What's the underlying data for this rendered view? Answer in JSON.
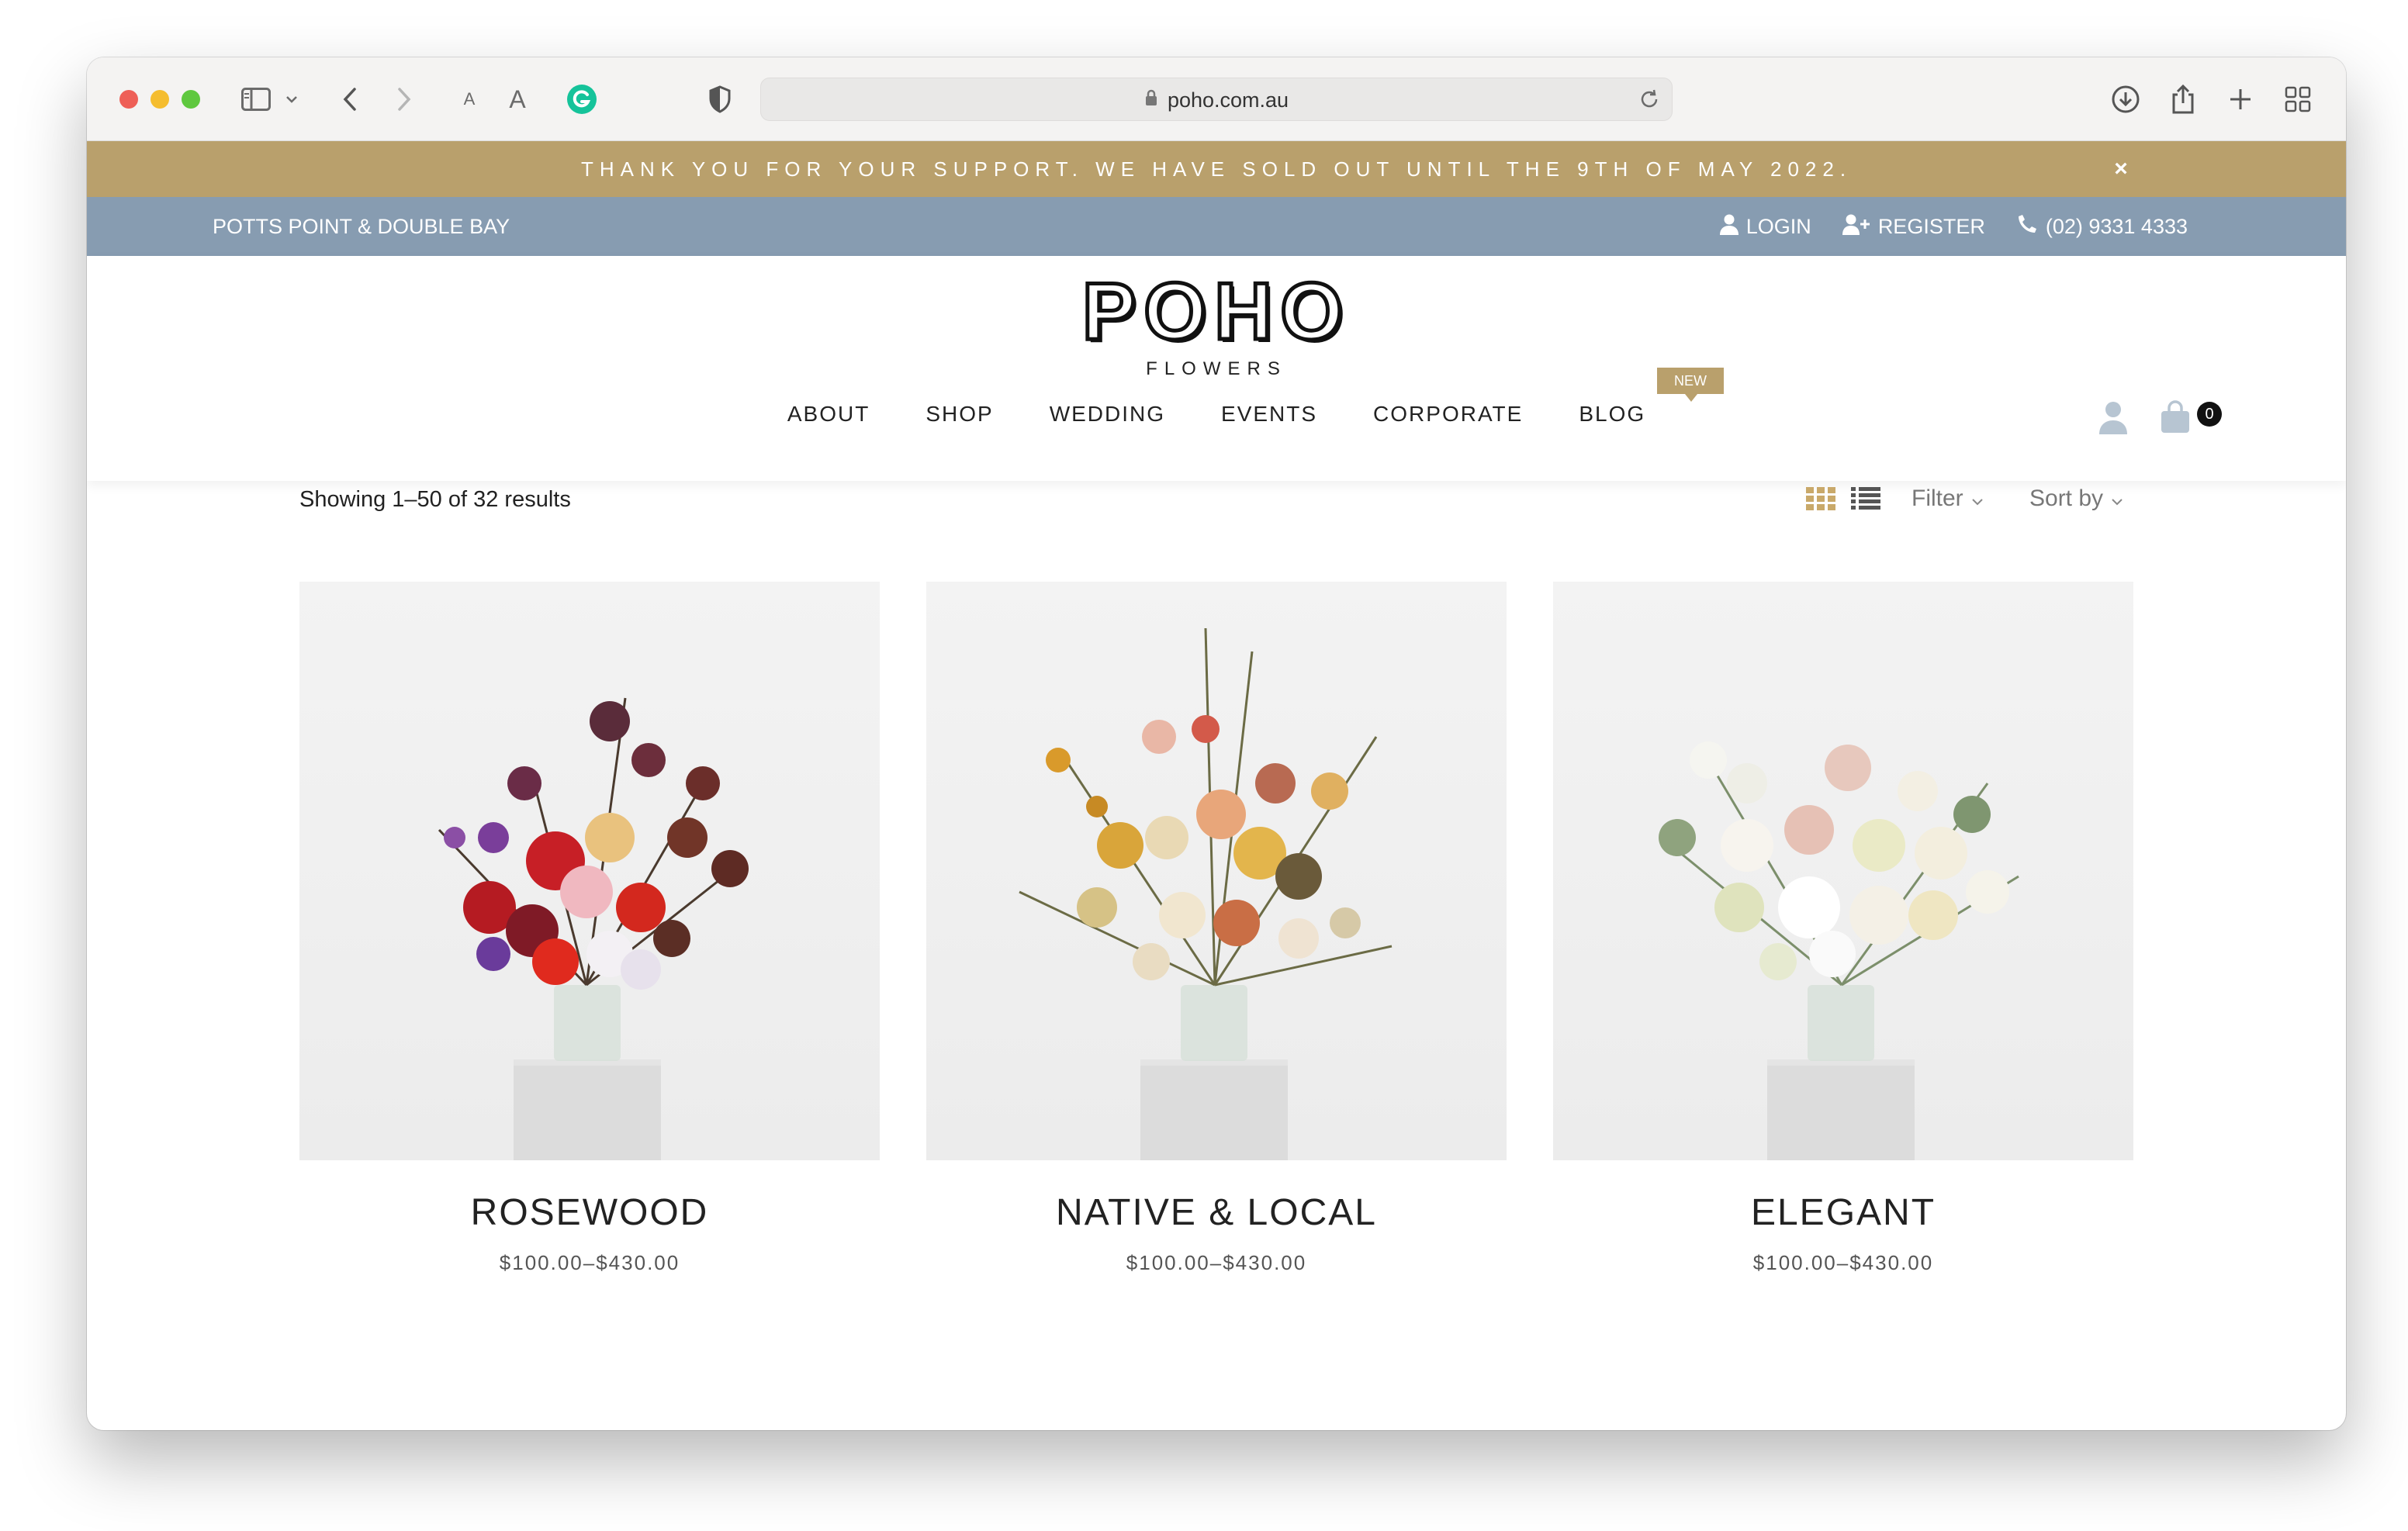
{
  "browser": {
    "url": "poho.com.au",
    "reader_small": "A",
    "reader_large": "A"
  },
  "announcement": {
    "text": "THANK YOU FOR YOUR SUPPORT. WE HAVE SOLD OUT UNTIL THE 9TH OF MAY 2022.",
    "close": "×"
  },
  "topbar": {
    "location": "POTTS POINT & DOUBLE BAY",
    "login": "LOGIN",
    "register": "REGISTER",
    "phone": "(02) 9331 4333"
  },
  "logo": {
    "word": "POHO",
    "sub": "FLOWERS"
  },
  "nav": {
    "items": [
      "ABOUT",
      "SHOP",
      "WEDDING",
      "EVENTS",
      "CORPORATE",
      "BLOG"
    ],
    "blog_badge": "NEW"
  },
  "cart": {
    "count": "0"
  },
  "shop": {
    "result_count": "Showing 1–50 of 32 results",
    "filter_label": "Filter",
    "sort_label": "Sort by"
  },
  "products": [
    {
      "name": "ROSEWOOD",
      "price": "$100.00–$430.00"
    },
    {
      "name": "NATIVE & LOCAL",
      "price": "$100.00–$430.00"
    },
    {
      "name": "ELEGANT",
      "price": "$100.00–$430.00"
    }
  ],
  "colors": {
    "announce_bg": "#b9a06c",
    "topbar_bg": "#879cb1",
    "grid_view_active": "#c9a96a"
  }
}
